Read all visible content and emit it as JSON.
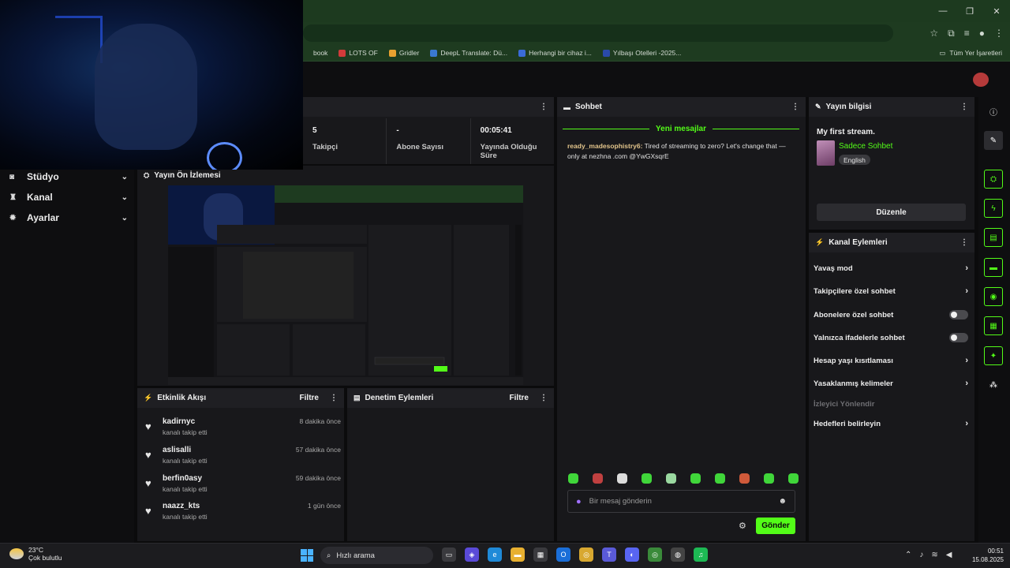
{
  "bookmarks": [
    {
      "label": "book",
      "color": "#1e3b20"
    },
    {
      "label": "LOTS OF",
      "color": "#d23a3a"
    },
    {
      "label": "Gridler",
      "color": "#e8a030"
    },
    {
      "label": "DeepL Translate: Dü...",
      "color": "#3a78d0"
    },
    {
      "label": "Herhangi bir cihaz i...",
      "color": "#3a6bd8"
    },
    {
      "label": "Yılbaşı Otelleri -2025...",
      "color": "#2a4aa8"
    }
  ],
  "bookmarks_all": "Tüm Yer İşaretleri",
  "nav": [
    {
      "label": "Stüdyo",
      "icon": "◙"
    },
    {
      "label": "Kanal",
      "icon": "♜"
    },
    {
      "label": "Ayarlar",
      "icon": "✹"
    }
  ],
  "stats": [
    {
      "value": "5",
      "label": "Takipçi"
    },
    {
      "value": "-",
      "label": "Abone Sayısı"
    },
    {
      "value": "00:05:41",
      "label": "Yayında Olduğu Süre"
    }
  ],
  "preview": {
    "title": "Yayın Ön İzlemesi"
  },
  "activity": {
    "title": "Etkinlik Akışı",
    "filter": "Filtre",
    "items": [
      {
        "user": "kadirnyc",
        "desc": "kanalı takip etti",
        "time": "8 dakika önce"
      },
      {
        "user": "aslisalli",
        "desc": "kanalı takip etti",
        "time": "57 dakika önce"
      },
      {
        "user": "berfin0asy",
        "desc": "kanalı takip etti",
        "time": "59 dakika önce"
      },
      {
        "user": "naazz_kts",
        "desc": "kanalı takip etti",
        "time": "1 gün önce"
      }
    ]
  },
  "moderation": {
    "title": "Denetim Eylemleri",
    "filter": "Filtre"
  },
  "chat": {
    "title": "Sohbet",
    "new_messages": "Yeni mesajlar",
    "message_user": "ready_madesophistry6:",
    "message_text": " Tired of streaming to zero? Let's change that — only at nezhna .com @YwGXsqrE",
    "placeholder": "Bir mesaj gönderin",
    "send": "Gönder"
  },
  "stream_info": {
    "title": "Yayın bilgisi",
    "stream_title": "My first stream.",
    "category": "Sadece Sohbet",
    "language": "English",
    "edit": "Düzenle"
  },
  "channel_actions": {
    "title": "Kanal Eylemleri",
    "items": [
      {
        "label": "Yavaş mod",
        "kind": "chevron"
      },
      {
        "label": "Takipçilere özel sohbet",
        "kind": "chevron"
      },
      {
        "label": "Abonelere özel sohbet",
        "kind": "toggle"
      },
      {
        "label": "Yalnızca ifadelerle sohbet",
        "kind": "toggle"
      },
      {
        "label": "Hesap yaşı kısıtlaması",
        "kind": "chevron"
      },
      {
        "label": "Yasaklanmış kelimeler",
        "kind": "chevron"
      },
      {
        "label": "İzleyici Yönlendir",
        "kind": "disabled"
      },
      {
        "label": "Hedefleri belirleyin",
        "kind": "chevron"
      }
    ]
  },
  "taskbar": {
    "temp": "23°C",
    "weather": "Çok bulutlu",
    "search": "Hızlı arama",
    "time": "00:51",
    "date": "15.08.2025"
  },
  "colors": {
    "accent": "#53fc18",
    "panel": "#18181b",
    "bg": "#0b0b0c"
  }
}
